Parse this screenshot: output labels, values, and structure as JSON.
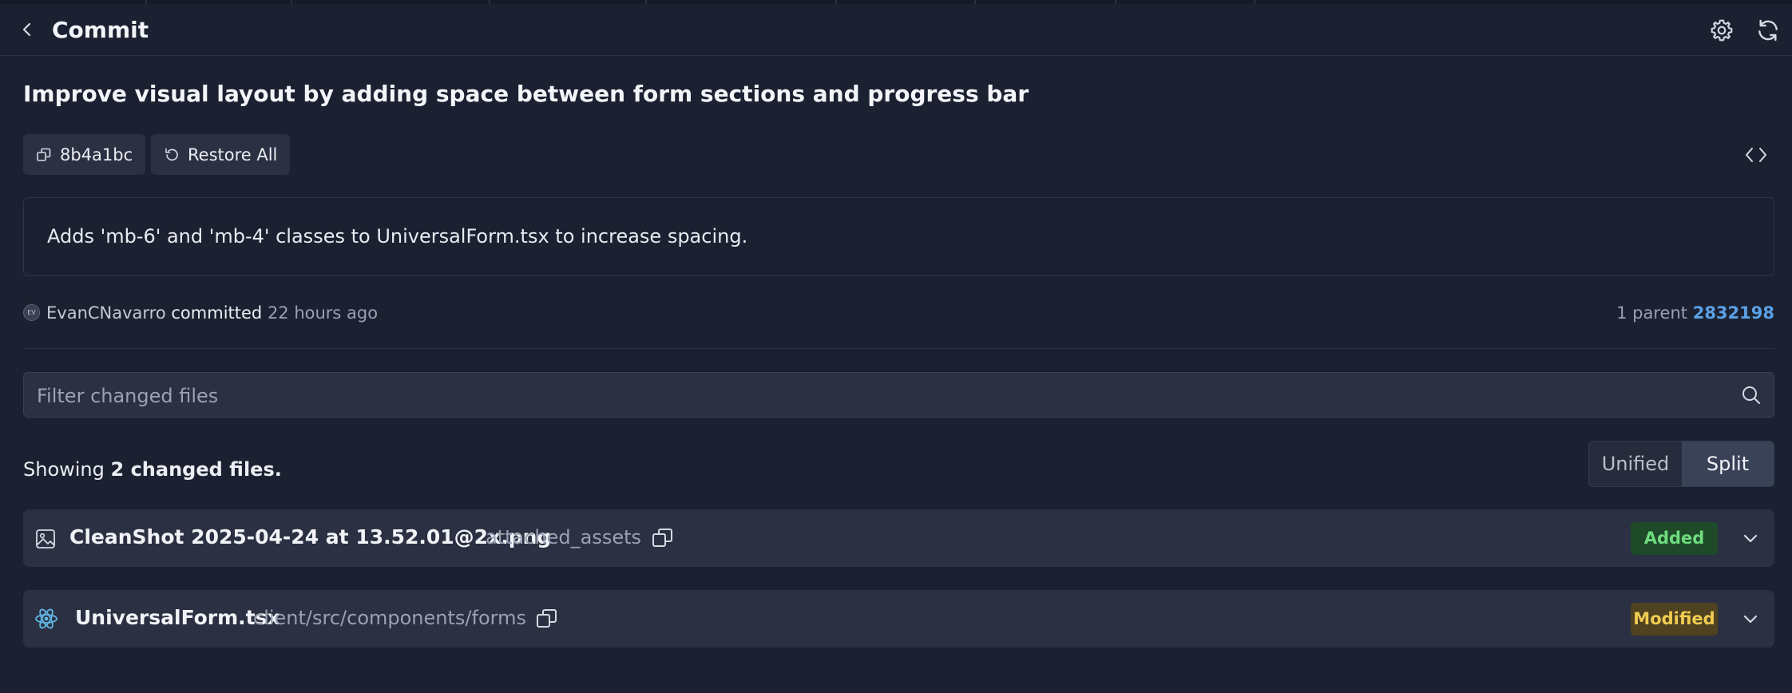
{
  "header": {
    "title": "Commit"
  },
  "commit": {
    "title": "Improve visual layout by adding space between form sections and progress bar",
    "hash": "8b4a1bc",
    "restore_label": "Restore All",
    "description": "Adds 'mb-6' and 'mb-4' classes to UniversalForm.tsx to increase spacing.",
    "author_initials": "EV",
    "author": "EvanCNavarro",
    "action": "committed",
    "time": "22 hours ago",
    "parent_label": "1 parent",
    "parent_hash": "2832198"
  },
  "filter": {
    "placeholder": "Filter changed files"
  },
  "summary": {
    "prefix": "Showing",
    "count": "2 changed files."
  },
  "view_toggle": {
    "unified": "Unified",
    "split": "Split",
    "selected": "Split"
  },
  "files": [
    {
      "name": "CleanShot 2025-04-24 at 13.52.01@2x.png",
      "path": "attached_assets",
      "status": "Added",
      "icon": "image-icon"
    },
    {
      "name": "UniversalForm.tsx",
      "path": "client/src/components/forms",
      "status": "Modified",
      "icon": "react-icon"
    }
  ],
  "colors": {
    "background": "#1c2131",
    "panel": "#2b3142",
    "link": "#5aa0e6",
    "added_bg": "#1f4a2a",
    "added_text": "#6fdc7f",
    "modified_bg": "#4f4220",
    "modified_text": "#f0cc52"
  }
}
